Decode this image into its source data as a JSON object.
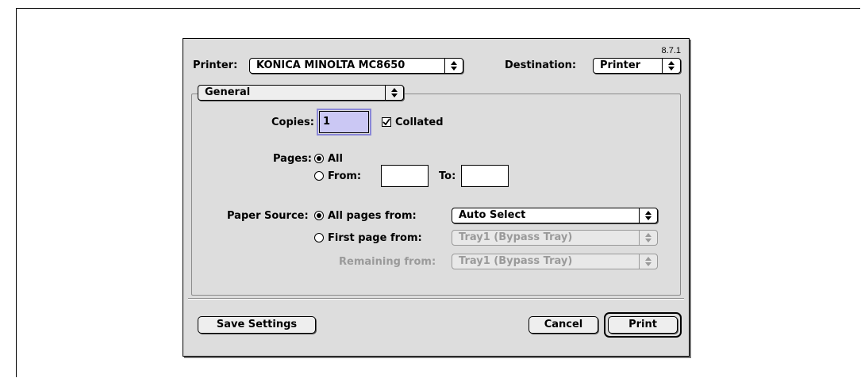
{
  "dialog": {
    "version": "8.7.1",
    "printer": {
      "label": "Printer:",
      "value": "KONICA MINOLTA MC8650"
    },
    "destination": {
      "label": "Destination:",
      "value": "Printer"
    },
    "panel_popup": "General",
    "copies": {
      "label": "Copies:",
      "value": "1"
    },
    "collated": {
      "label": "Collated",
      "checked": true
    },
    "pages": {
      "label": "Pages:",
      "all_label": "All",
      "from_label": "From:",
      "to_label": "To:",
      "from_value": "",
      "to_value": "",
      "selected": "All"
    },
    "paper_source": {
      "label": "Paper Source:",
      "all_pages_label": "All pages from:",
      "all_pages_value": "Auto Select",
      "first_page_label": "First page from:",
      "first_page_value": "Tray1 (Bypass Tray)",
      "remaining_label": "Remaining from:",
      "remaining_value": "Tray1 (Bypass Tray)",
      "selected": "All pages from:"
    },
    "buttons": {
      "save_settings": "Save Settings",
      "cancel": "Cancel",
      "print": "Print"
    },
    "icons": {
      "popup_arrow": "updown-arrow-icon",
      "check": "checkmark-icon"
    }
  }
}
